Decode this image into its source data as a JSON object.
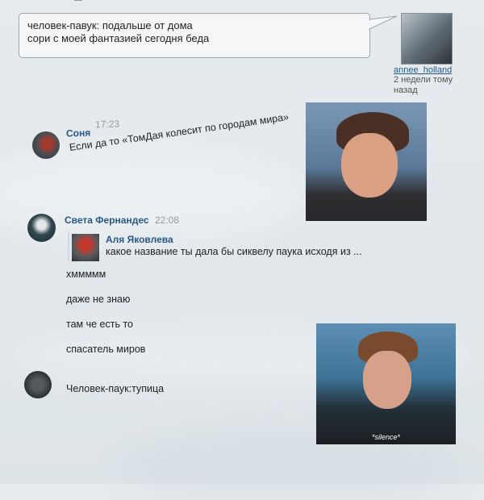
{
  "note": {
    "lines": [
      "человек-павук: подальше от дома",
      "сори с моей фантазией сегодня беда"
    ],
    "username": "annee_holland",
    "time": "2 недели тому назад"
  },
  "messages": {
    "sonya": {
      "author": "Соня",
      "time": "17:23",
      "text": "Если да то «ТомДая колесит по городам мира»"
    },
    "sveta": {
      "author": "Света Фернандес",
      "time": "22:08",
      "quote": {
        "author": "Аля Яковлева",
        "text": "какое название ты дала бы сиквелу паука исходя из ..."
      },
      "lines": [
        "хммммм",
        "даже не знаю",
        "там че есть то",
        "спасатель миров"
      ]
    },
    "reply": {
      "text": "Человек-паук:тупица"
    }
  },
  "photos": {
    "second_caption": "*silence*"
  },
  "icons": {
    "sonya_avatar": "user-avatar-icon",
    "sveta_avatar": "user-avatar-icon",
    "reply_avatar": "user-avatar-icon"
  },
  "colors": {
    "name_link": "#2a5885",
    "timestamp": "#939ba1",
    "bubble_border": "#9fa6ab"
  }
}
